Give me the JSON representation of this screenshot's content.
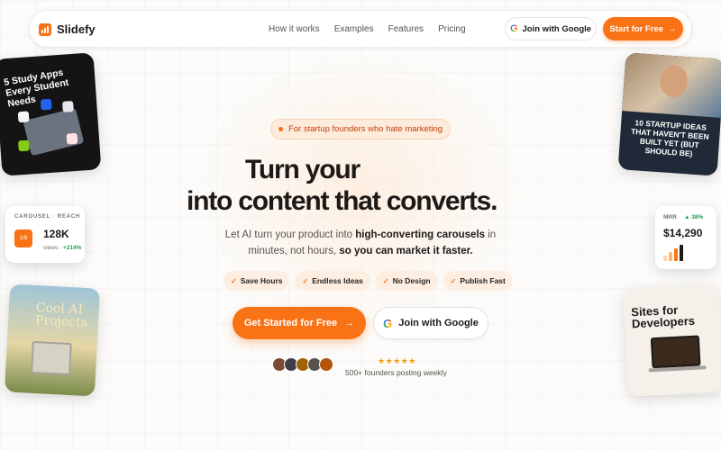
{
  "brand": {
    "name": "Slidefy",
    "accent": "#f97316"
  },
  "nav": {
    "links": [
      "How it works",
      "Examples",
      "Features",
      "Pricing"
    ],
    "google_label": "Join with Google",
    "cta_label": "Start for Free",
    "cta_arrow": "→"
  },
  "hero": {
    "pill": "For startup founders who hate marketing",
    "headline_line1": "Turn your",
    "headline_line2": "into content that converts.",
    "sub_part1": "Let AI turn your product into ",
    "sub_bold1": "high-converting carousels",
    "sub_part2": " in minutes, not hours, ",
    "sub_bold2": "so you can market it faster.",
    "chips": [
      "Save Hours",
      "Endless Ideas",
      "No Design",
      "Publish Fast"
    ],
    "chip_check": "✓",
    "primary_cta": "Get Started for Free",
    "primary_arrow": "→",
    "google_cta": "Join with Google",
    "stars": "★★★★★",
    "social_proof": "500+ founders posting weekly"
  },
  "cards": {
    "study": {
      "title": "5 Study Apps Every Student Needs"
    },
    "reach": {
      "label": "CAROUSEL · REACH",
      "badge": "1/8",
      "value": "128K",
      "sub_prefix": "views · ",
      "sub_delta": "+214%"
    },
    "cool": {
      "title": "Cool AI Projects"
    },
    "startup": {
      "title": "10 STARTUP IDEAS THAT HAVEN'T BEEN BUILT YET (BUT SHOULD BE)"
    },
    "mrr": {
      "label": "MRR",
      "delta": "▲ 38%",
      "value": "$14,290"
    },
    "sites": {
      "title": "Sites for Developers"
    }
  }
}
